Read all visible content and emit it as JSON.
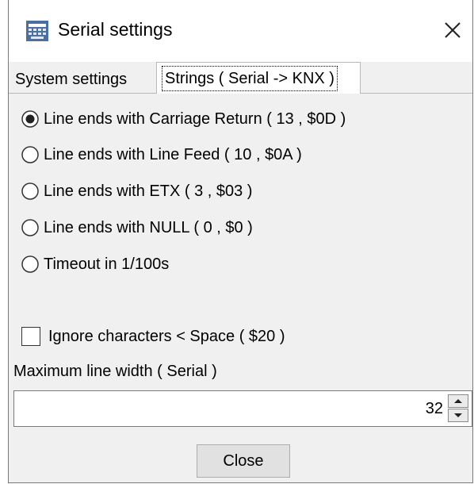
{
  "window": {
    "title": "Serial settings"
  },
  "tabs": [
    {
      "label": "System settings"
    },
    {
      "label": "Strings ( Serial -> KNX )"
    }
  ],
  "line_end_options": [
    {
      "label": "Line ends with Carriage Return ( 13 , $0D )",
      "selected": true
    },
    {
      "label": "Line ends with Line Feed ( 10 , $0A )",
      "selected": false
    },
    {
      "label": "Line ends with ETX ( 3 , $03 )",
      "selected": false
    },
    {
      "label": "Line ends with NULL ( 0 , $0 )",
      "selected": false
    },
    {
      "label": "Timeout in 1/100s",
      "selected": false
    }
  ],
  "ignore_checkbox": {
    "label": "Ignore characters < Space ( $20 )",
    "checked": false
  },
  "max_width": {
    "label": "Maximum line width ( Serial )",
    "value": "32"
  },
  "buttons": {
    "close": "Close"
  }
}
